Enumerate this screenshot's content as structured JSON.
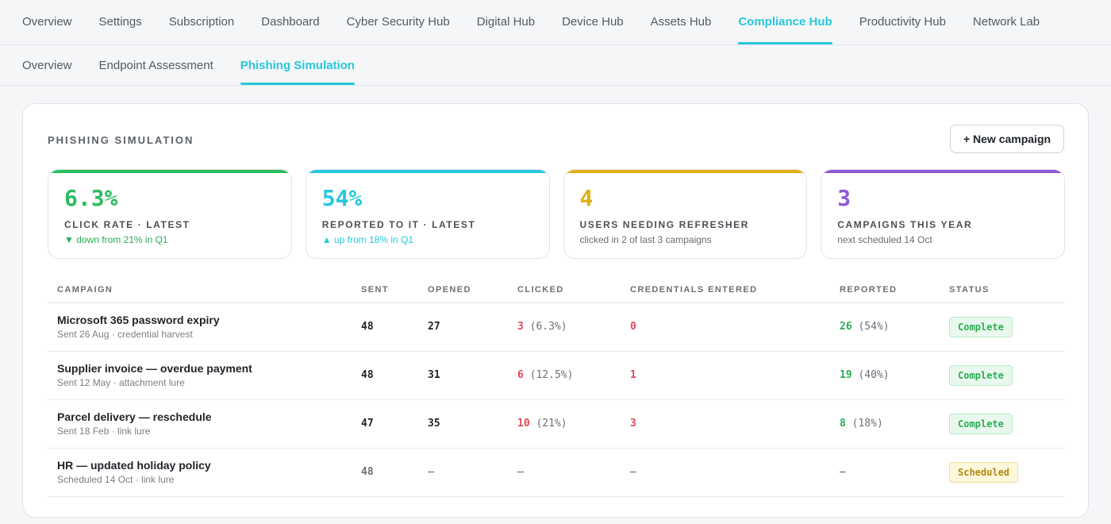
{
  "nav": {
    "top": [
      "Overview",
      "Settings",
      "Subscription",
      "Dashboard",
      "Cyber Security Hub",
      "Digital Hub",
      "Device Hub",
      "Assets Hub",
      "Compliance Hub",
      "Productivity Hub",
      "Network Lab"
    ],
    "top_active": "Compliance Hub",
    "sub": [
      "Overview",
      "Endpoint Assessment",
      "Phishing Simulation"
    ],
    "sub_active": "Phishing Simulation"
  },
  "card": {
    "title": "PHISHING SIMULATION",
    "new_button": "+ New campaign"
  },
  "stats": [
    {
      "value": "6.3%",
      "label": "CLICK RATE · LATEST",
      "note": "▼ down from 21% in Q1",
      "accent": "#2bbd5e",
      "note_style": "green"
    },
    {
      "value": "54%",
      "label": "REPORTED TO IT · LATEST",
      "note": "▲ up from 18% in Q1",
      "accent": "#27c8dc",
      "note_style": "cyan"
    },
    {
      "value": "4",
      "label": "USERS NEEDING REFRESHER",
      "note": "clicked in 2 of last 3 campaigns",
      "accent": "#e0b012",
      "note_style": "plain"
    },
    {
      "value": "3",
      "label": "CAMPAIGNS THIS YEAR",
      "note": "next scheduled 14 Oct",
      "accent": "#8c5ad8",
      "note_style": "plain"
    }
  ],
  "table": {
    "headers": {
      "campaign": "CAMPAIGN",
      "sent": "SENT",
      "opened": "OPENED",
      "clicked": "CLICKED",
      "credentials": "CREDENTIALS ENTERED",
      "reported": "REPORTED",
      "status": "STATUS"
    },
    "rows": [
      {
        "name": "Microsoft 365 password expiry",
        "sub": "Sent 26 Aug · credential harvest",
        "sent": "48",
        "opened": "27",
        "clicked": "3",
        "clicked_pct": "(6.3%)",
        "credentials": "0",
        "reported": "26",
        "reported_pct": "(54%)",
        "status": "Complete"
      },
      {
        "name": "Supplier invoice — overdue payment",
        "sub": "Sent 12 May · attachment lure",
        "sent": "48",
        "opened": "31",
        "clicked": "6",
        "clicked_pct": "(12.5%)",
        "credentials": "1",
        "reported": "19",
        "reported_pct": "(40%)",
        "status": "Complete"
      },
      {
        "name": "Parcel delivery — reschedule",
        "sub": "Sent 18 Feb · link lure",
        "sent": "47",
        "opened": "35",
        "clicked": "10",
        "clicked_pct": "(21%)",
        "credentials": "3",
        "reported": "8",
        "reported_pct": "(18%)",
        "status": "Complete"
      },
      {
        "name": "HR — updated holiday policy",
        "sub": "Scheduled 14 Oct · link lure",
        "sent": "48",
        "opened": "–",
        "clicked": "–",
        "clicked_pct": "",
        "credentials": "–",
        "reported": "–",
        "reported_pct": "",
        "status": "Scheduled"
      }
    ]
  }
}
